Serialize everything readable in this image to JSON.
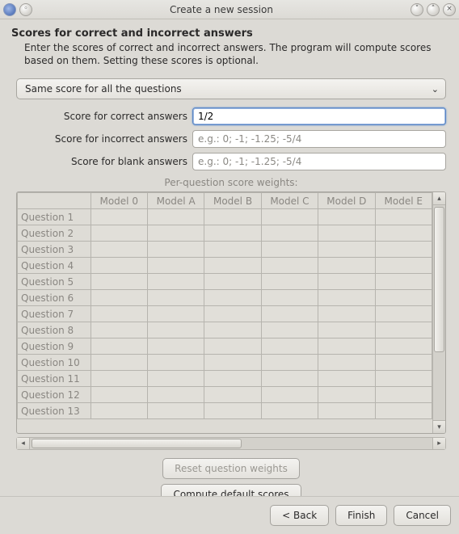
{
  "window": {
    "title": "Create a new session"
  },
  "header": {
    "heading": "Scores for correct and incorrect answers",
    "description": "Enter the scores of correct and incorrect answers. The program will compute scores based on them. Setting these scores is optional."
  },
  "dropdown": {
    "selected": "Same score for all the questions"
  },
  "fields": {
    "correct": {
      "label": "Score for correct answers",
      "value": "1/2",
      "placeholder": ""
    },
    "incorrect": {
      "label": "Score for incorrect answers",
      "value": "",
      "placeholder": "e.g.: 0; -1; -1.25; -5/4"
    },
    "blank": {
      "label": "Score for blank answers",
      "value": "",
      "placeholder": "e.g.: 0; -1; -1.25; -5/4"
    }
  },
  "weights": {
    "title": "Per-question score weights:",
    "columns": [
      "Model 0",
      "Model A",
      "Model B",
      "Model C",
      "Model D",
      "Model E"
    ],
    "rows": [
      "Question 1",
      "Question 2",
      "Question 3",
      "Question 4",
      "Question 5",
      "Question 6",
      "Question 7",
      "Question 8",
      "Question 9",
      "Question 10",
      "Question 11",
      "Question 12",
      "Question 13"
    ]
  },
  "buttons": {
    "reset": "Reset question weights",
    "compute": "Compute default scores",
    "back": "< Back",
    "finish": "Finish",
    "cancel": "Cancel"
  }
}
